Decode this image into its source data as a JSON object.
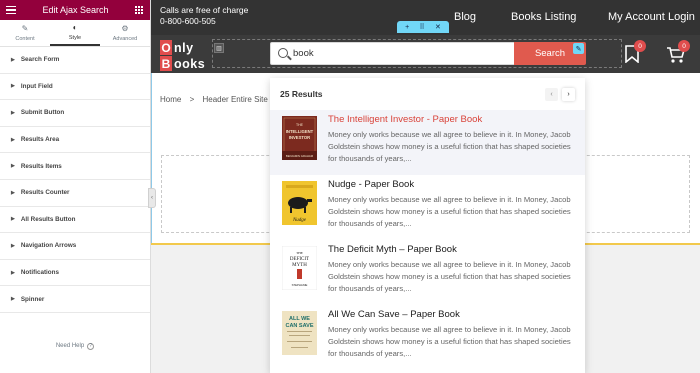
{
  "panel": {
    "title": "Edit Ajax Search",
    "tabs": [
      {
        "label": "Content",
        "icon": "pencil-icon"
      },
      {
        "label": "Style",
        "icon": "contrast-icon"
      },
      {
        "label": "Advanced",
        "icon": "gear-icon"
      }
    ],
    "active_tab": "Style",
    "sections": [
      "Search Form",
      "Input Field",
      "Submit Button",
      "Results Area",
      "Results Items",
      "Results Counter",
      "All Results Button",
      "Navigation Arrows",
      "Notifications",
      "Spinner"
    ],
    "need_help": "Need Help"
  },
  "topbar": {
    "calls_line1": "Calls are free of charge",
    "calls_line2": "0-800-600-505",
    "nav": [
      "Blog",
      "Books Listing",
      "My Account",
      "Login"
    ]
  },
  "header": {
    "logo": {
      "o": "O",
      "nly": "nly",
      "b": "B",
      "ooks": "ooks"
    },
    "search_value": "book",
    "search_button": "Search",
    "wishlist_count": "0",
    "cart_count": "0"
  },
  "breadcrumb": [
    "Home",
    ">",
    "Header Entire Site"
  ],
  "results": {
    "count": "25 Results",
    "items": [
      {
        "title": "The Intelligent Investor - Paper Book",
        "desc": "Money only works because we all agree to believe in it. In Money, Jacob Goldstein shows how money is a useful fiction that has shaped societies for thousands of years,..."
      },
      {
        "title": "Nudge - Paper Book",
        "desc": "Money only works because we all agree to believe in it. In Money, Jacob Goldstein shows how money is a useful fiction that has shaped societies for thousands of years,..."
      },
      {
        "title": "The Deficit Myth – Paper Book",
        "desc": "Money only works because we all agree to believe in it. In Money, Jacob Goldstein shows how money is a useful fiction that has shaped societies for thousands of years,..."
      },
      {
        "title": "All We Can Save – Paper Book",
        "desc": "Money only works because we all agree to believe in it. In Money, Jacob Goldstein shows how money is a useful fiction that has shaped societies for thousands of years,..."
      }
    ]
  },
  "covers": {
    "intelligent": {
      "line1": "THE",
      "line2": "INTELLIGENT",
      "line3": "INVESTOR",
      "author": "BENJAMIN GRAHAM"
    },
    "nudge": {
      "title": "Nudge"
    },
    "deficit": {
      "line1": "THE",
      "line2": "DEFICIT",
      "line3": "MYTH",
      "author": "STEPHANIE"
    },
    "allwecansave": {
      "line1": "ALL WE",
      "line2": "CAN SAVE"
    }
  },
  "colors": {
    "panel_header": "#93003c",
    "topbar": "#333333",
    "accent_red": "#e05a4e",
    "edit_blue": "#71d7f7"
  }
}
